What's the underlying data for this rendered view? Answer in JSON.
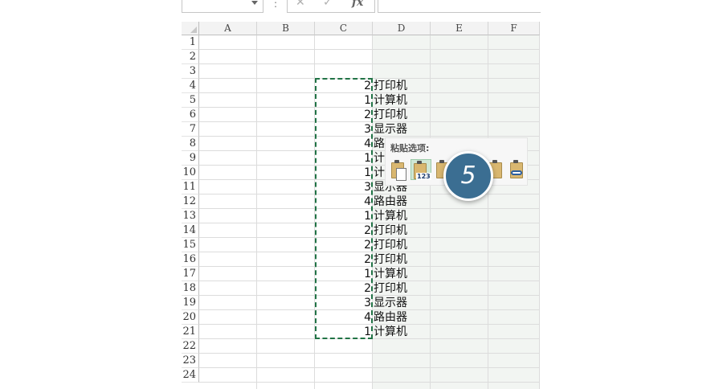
{
  "formula_bar": {
    "name_box": "",
    "separator": ":",
    "cancel_glyph": "✕",
    "enter_glyph": "✓",
    "fx_label": "fx",
    "content": ""
  },
  "grid": {
    "columns": [
      "A",
      "B",
      "C",
      "D",
      "E",
      "F"
    ],
    "rows": [
      "1",
      "2",
      "3",
      "4",
      "5",
      "6",
      "7",
      "8",
      "9",
      "10",
      "11",
      "12",
      "13",
      "14",
      "15",
      "16",
      "17",
      "18",
      "19",
      "20",
      "21",
      "22",
      "23",
      "24"
    ],
    "column_c_values": [
      "2",
      "1",
      "2",
      "3",
      "4",
      "1",
      "1",
      "3",
      "4",
      "1",
      "2",
      "2",
      "2",
      "1",
      "2",
      "3",
      "4",
      "1"
    ],
    "column_d_values": [
      "打印机",
      "计算机",
      "打印机",
      "显示器",
      "路",
      "计",
      "计",
      "显示器",
      "路由器",
      "计算机",
      "打印机",
      "打印机",
      "打印机",
      "计算机",
      "打印机",
      "显示器",
      "路由器",
      "计算机"
    ]
  },
  "paste_options": {
    "title": "粘贴选项:",
    "icons": [
      "paste-icon",
      "paste-values-icon",
      "paste-formulas-icon",
      "paste-formatting-icon",
      "paste-link-icon"
    ],
    "values_badge": "123"
  },
  "step_badge": "5",
  "colors": {
    "marquee": "#217346",
    "badge": "#3b6e92",
    "selected_icon_bg": "#cfe8d6"
  }
}
